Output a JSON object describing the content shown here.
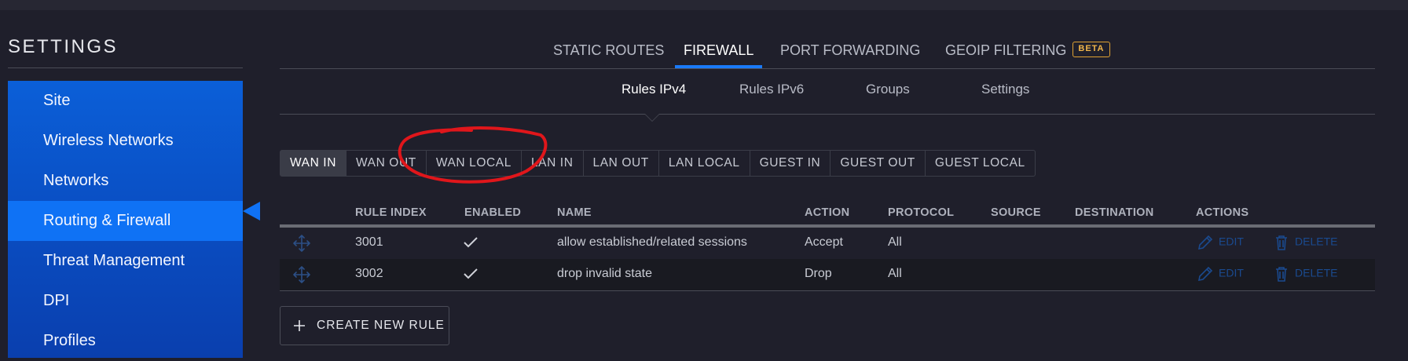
{
  "sidebar": {
    "title": "SETTINGS",
    "items": [
      {
        "label": "Site",
        "active": false
      },
      {
        "label": "Wireless Networks",
        "active": false
      },
      {
        "label": "Networks",
        "active": false
      },
      {
        "label": "Routing & Firewall",
        "active": true
      },
      {
        "label": "Threat Management",
        "active": false
      },
      {
        "label": "DPI",
        "active": false
      },
      {
        "label": "Profiles",
        "active": false
      }
    ]
  },
  "main_tabs": [
    {
      "label": "STATIC ROUTES"
    },
    {
      "label": "FIREWALL",
      "active": true
    },
    {
      "label": "PORT FORWARDING"
    },
    {
      "label": "GEOIP FILTERING",
      "badge": "BETA"
    }
  ],
  "sub_tabs": [
    {
      "label": "Rules IPv4",
      "active": true
    },
    {
      "label": "Rules IPv6"
    },
    {
      "label": "Groups"
    },
    {
      "label": "Settings"
    }
  ],
  "rule_sets": [
    {
      "label": "WAN IN",
      "active": true
    },
    {
      "label": "WAN OUT"
    },
    {
      "label": "WAN LOCAL"
    },
    {
      "label": "LAN IN"
    },
    {
      "label": "LAN OUT"
    },
    {
      "label": "LAN LOCAL"
    },
    {
      "label": "GUEST IN"
    },
    {
      "label": "GUEST OUT"
    },
    {
      "label": "GUEST LOCAL"
    }
  ],
  "table": {
    "headers": {
      "rule_index": "RULE INDEX",
      "enabled": "ENABLED",
      "name": "NAME",
      "action": "ACTION",
      "protocol": "PROTOCOL",
      "source": "SOURCE",
      "destination": "DESTINATION",
      "actions": "ACTIONS"
    },
    "rows": [
      {
        "rule_index": "3001",
        "enabled": true,
        "name": "allow established/related sessions",
        "action": "Accept",
        "protocol": "All",
        "source": "",
        "destination": ""
      },
      {
        "rule_index": "3002",
        "enabled": true,
        "name": "drop invalid state",
        "action": "Drop",
        "protocol": "All",
        "source": "",
        "destination": ""
      }
    ],
    "edit_label": "EDIT",
    "delete_label": "DELETE"
  },
  "create_button": {
    "label": "CREATE NEW RULE"
  },
  "colors": {
    "accent": "#1a7af8",
    "sidebar": "#0b5fd8",
    "sidebar_active": "#0f72f5",
    "beta": "#e0a233",
    "annotation": "#e0161b",
    "background": "#1f1f2b"
  },
  "icons": {
    "drag": "move-icon",
    "enabled": "check-icon",
    "edit": "pencil-icon",
    "delete": "trash-icon",
    "create": "plus-icon"
  }
}
